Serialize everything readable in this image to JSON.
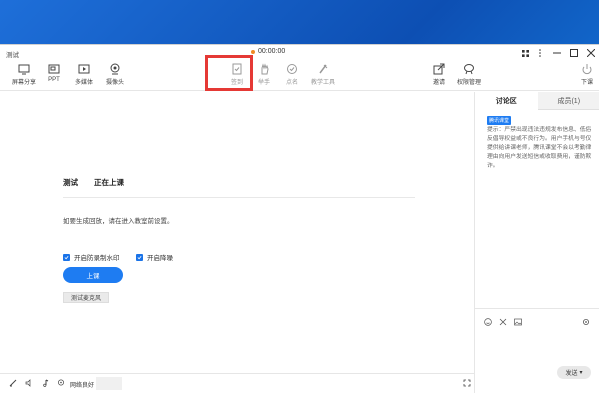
{
  "window": {
    "title": "测试",
    "timer": "00:00:00"
  },
  "toolbar": {
    "items": [
      {
        "label": "屏幕分享",
        "icon": "screen-share-icon"
      },
      {
        "label": "PPT",
        "icon": "ppt-icon"
      },
      {
        "label": "多媒体",
        "icon": "media-icon"
      },
      {
        "label": "摄像头",
        "icon": "camera-icon"
      },
      {
        "label": "签到",
        "icon": "checkin-icon"
      },
      {
        "label": "举手",
        "icon": "raise-hand-icon"
      },
      {
        "label": "点名",
        "icon": "roll-call-icon"
      },
      {
        "label": "教学工具",
        "icon": "teaching-tools-icon"
      },
      {
        "label": "邀请",
        "icon": "invite-icon"
      },
      {
        "label": "权限管理",
        "icon": "permission-icon"
      },
      {
        "label": "下课",
        "icon": "end-class-icon"
      }
    ]
  },
  "course": {
    "name": "测试",
    "status": "正在上课",
    "hint": "如要生成回放，请在进入教室前设置。",
    "options": [
      {
        "label": "开启防录制水印",
        "checked": true
      },
      {
        "label": "开启降噪",
        "checked": true
      }
    ],
    "start_button": "上课",
    "mic_test_button": "测试麦克风"
  },
  "bottombar": {
    "network_status": "网络良好"
  },
  "sidebar": {
    "tabs": [
      {
        "label": "讨论区",
        "active": true
      },
      {
        "label": "成员(1)",
        "active": false
      }
    ],
    "notice_badge": "腾讯课堂",
    "notice_text": "提示：严禁出现违法违规发布信息、低俗反倡导权益或不良行为。用户手机与号仅提供给讲课老师，腾讯课堂不会以考勤律理由向用户发送短信或收取费用，谨防欺诈。",
    "send_button": "发送"
  },
  "colors": {
    "accent": "#1e7cf2",
    "highlight": "#e53935",
    "timer_dot": "#f08a24"
  }
}
